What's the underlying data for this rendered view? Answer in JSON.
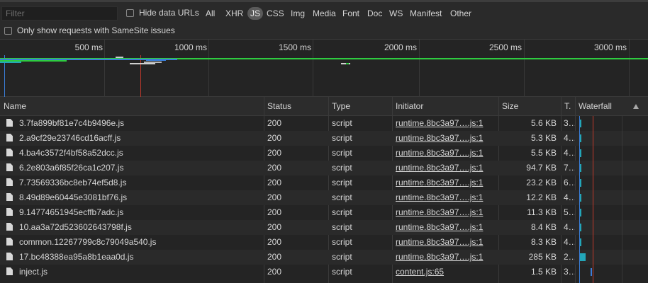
{
  "filter": {
    "placeholder": "Filter",
    "value": ""
  },
  "hide_data_urls": {
    "label": "Hide data URLs",
    "checked": false
  },
  "types": [
    "All",
    "XHR",
    "JS",
    "CSS",
    "Img",
    "Media",
    "Font",
    "Doc",
    "WS",
    "Manifest",
    "Other"
  ],
  "active_type": "JS",
  "samesite": {
    "label": "Only show requests with SameSite issues",
    "checked": false
  },
  "overview_ticks": [
    "500 ms",
    "1000 ms",
    "1500 ms",
    "2000 ms",
    "2500 ms",
    "3000 ms"
  ],
  "columns": {
    "name": "Name",
    "status": "Status",
    "type": "Type",
    "initiator": "Initiator",
    "size": "Size",
    "time": "T.",
    "waterfall": "Waterfall",
    "sort_icon": "sort-ascending-triangle"
  },
  "rows": [
    {
      "name": "3.7fa899bf81e7c4b9496e.js",
      "status": "200",
      "type": "script",
      "initiator": "runtime.8bc3a97….js:1",
      "size": "5.6 KB",
      "time": "3…"
    },
    {
      "name": "2.a9cf29e23746cd16acff.js",
      "status": "200",
      "type": "script",
      "initiator": "runtime.8bc3a97….js:1",
      "size": "5.3 KB",
      "time": "4…"
    },
    {
      "name": "4.ba4c3572f4bf58a52dcc.js",
      "status": "200",
      "type": "script",
      "initiator": "runtime.8bc3a97….js:1",
      "size": "5.5 KB",
      "time": "4…"
    },
    {
      "name": "6.2e803a6f85f26ca1c207.js",
      "status": "200",
      "type": "script",
      "initiator": "runtime.8bc3a97….js:1",
      "size": "94.7 KB",
      "time": "7…"
    },
    {
      "name": "7.73569336bc8eb74ef5d8.js",
      "status": "200",
      "type": "script",
      "initiator": "runtime.8bc3a97….js:1",
      "size": "23.2 KB",
      "time": "6…"
    },
    {
      "name": "8.49d89e60445e3081bf76.js",
      "status": "200",
      "type": "script",
      "initiator": "runtime.8bc3a97….js:1",
      "size": "12.2 KB",
      "time": "4…"
    },
    {
      "name": "9.14774651945ecffb7adc.js",
      "status": "200",
      "type": "script",
      "initiator": "runtime.8bc3a97….js:1",
      "size": "11.3 KB",
      "time": "5…"
    },
    {
      "name": "10.aa3a72d523602643798f.js",
      "status": "200",
      "type": "script",
      "initiator": "runtime.8bc3a97….js:1",
      "size": "8.4 KB",
      "time": "4…"
    },
    {
      "name": "common.12267799c8c79049a540.js",
      "status": "200",
      "type": "script",
      "initiator": "runtime.8bc3a97….js:1",
      "size": "8.3 KB",
      "time": "4…"
    },
    {
      "name": "17.bc48388ea95a8b1eaa0d.js",
      "status": "200",
      "type": "script",
      "initiator": "runtime.8bc3a97….js:1",
      "size": "285 KB",
      "time": "2…"
    },
    {
      "name": "inject.js",
      "status": "200",
      "type": "script",
      "initiator": "content.js:65",
      "size": "1.5 KB",
      "time": "3…"
    }
  ],
  "colors": {
    "accent_blue": "#3a7ed8",
    "waterfall_teal": "#23a6b8",
    "load_red": "#c0392b",
    "dcl_green": "#2ecc40"
  }
}
